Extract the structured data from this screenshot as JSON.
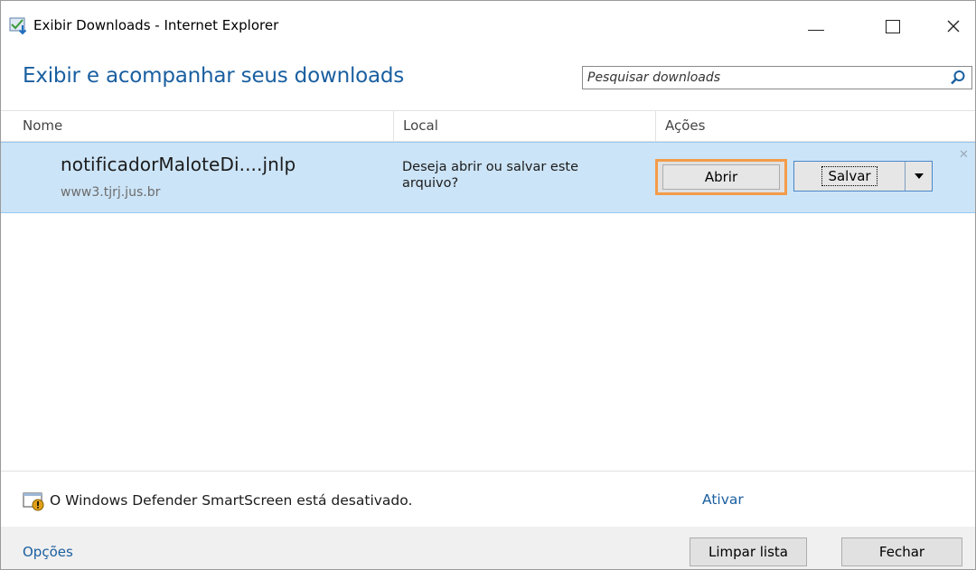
{
  "window": {
    "title": "Exibir Downloads - Internet Explorer",
    "controls": {
      "minimize": "minimize-icon",
      "maximize": "maximize-icon",
      "close": "close-icon"
    }
  },
  "header": {
    "title": "Exibir e acompanhar seus downloads",
    "search_placeholder": "Pesquisar downloads",
    "search_value": ""
  },
  "columns": [
    "Nome",
    "Local",
    "Ações"
  ],
  "downloads": [
    {
      "name": "notificadorMaloteDi....jnlp",
      "source": "www3.tjrj.jus.br",
      "status": "Deseja abrir ou salvar este arquivo?",
      "open_label": "Abrir",
      "save_label": "Salvar"
    }
  ],
  "status_bar": {
    "message": "O Windows Defender SmartScreen está desativado.",
    "action": "Ativar"
  },
  "footer": {
    "options": "Opções",
    "clear_list": "Limpar lista",
    "close": "Fechar"
  },
  "colors": {
    "accent": "#1a5fa0",
    "row_highlight": "#cce4f7",
    "open_highlight": "#f39c4a"
  }
}
